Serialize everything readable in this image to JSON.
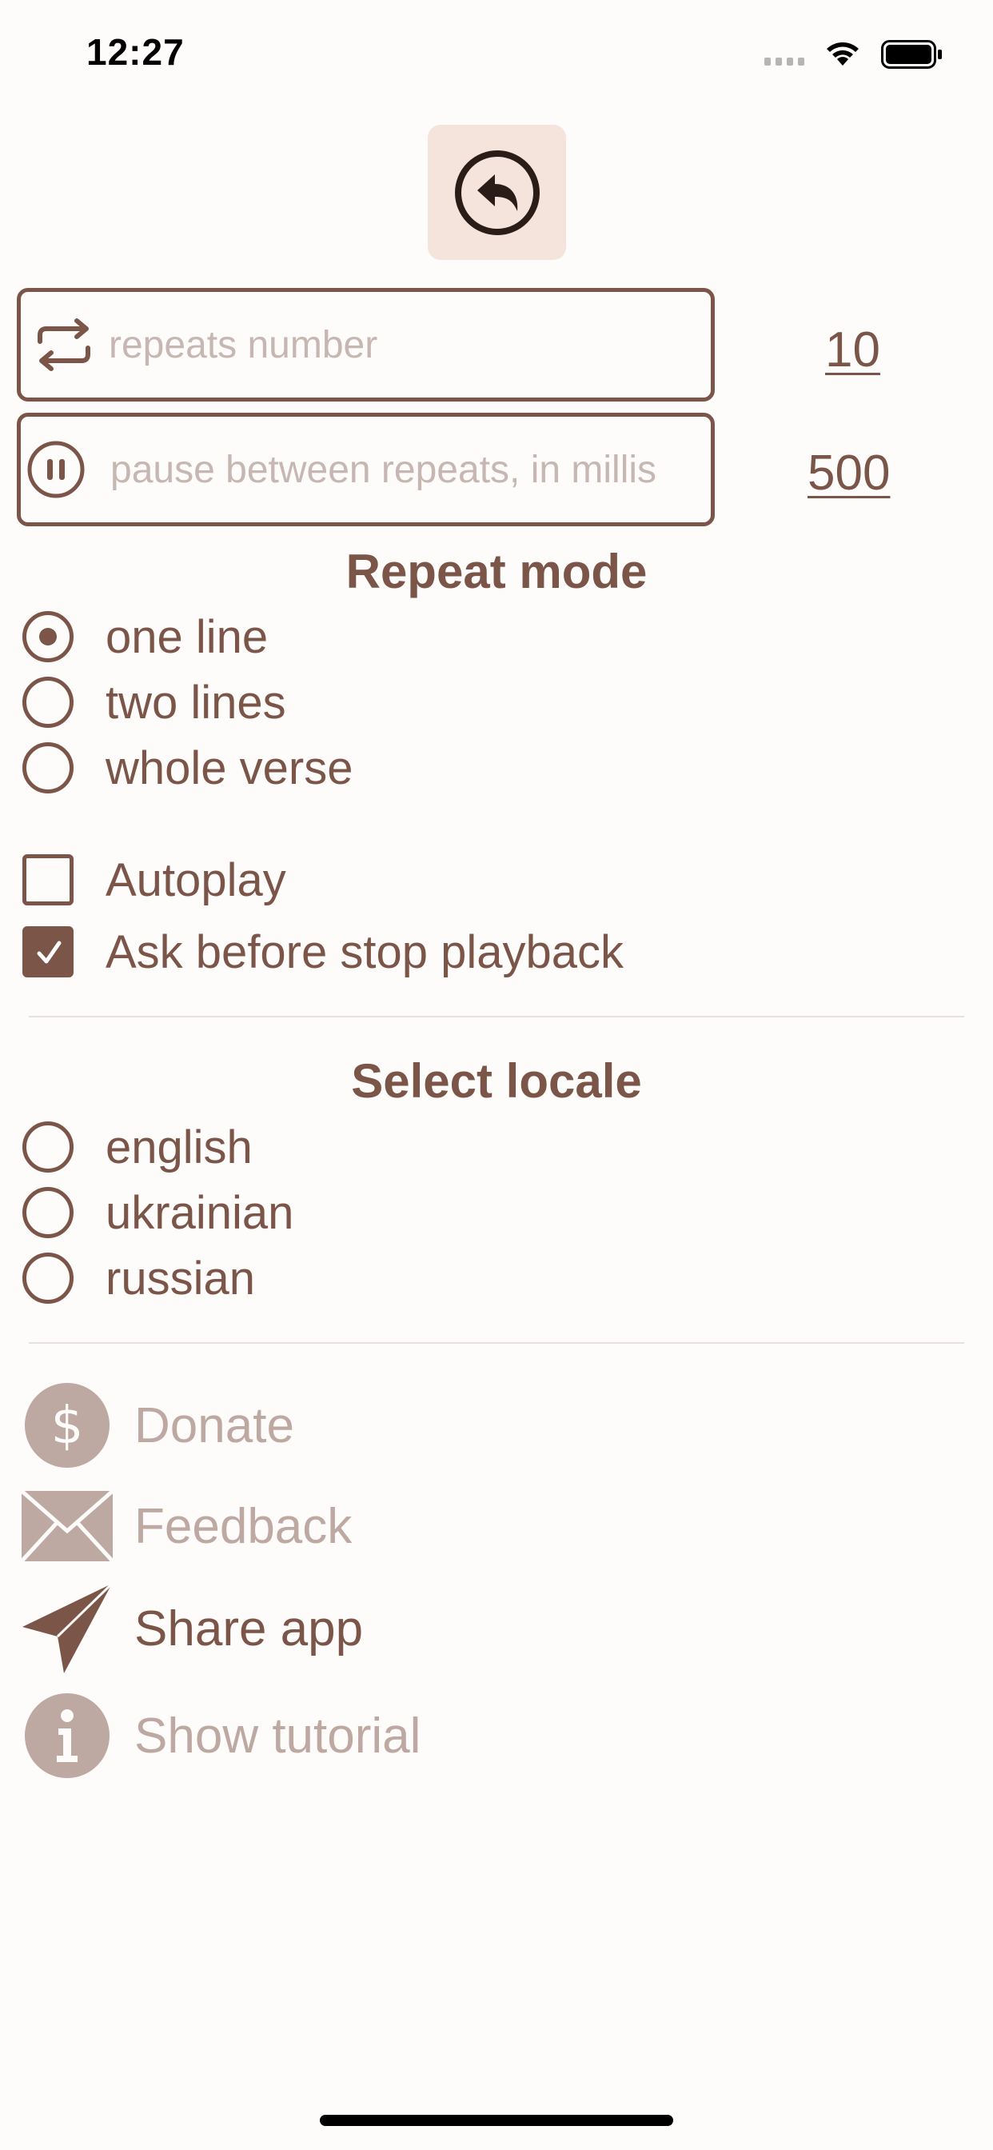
{
  "status_bar": {
    "time": "12:27"
  },
  "settings": {
    "repeats_field": {
      "placeholder": "repeats number",
      "value": "",
      "current": "10"
    },
    "pause_field": {
      "placeholder": "pause between repeats, in millis",
      "value": "",
      "current": "500"
    }
  },
  "repeat_mode": {
    "title": "Repeat mode",
    "options": [
      {
        "label": "one line",
        "selected": true
      },
      {
        "label": "two lines",
        "selected": false
      },
      {
        "label": "whole verse",
        "selected": false
      }
    ]
  },
  "toggles": [
    {
      "label": "Autoplay",
      "checked": false
    },
    {
      "label": "Ask before stop playback",
      "checked": true
    }
  ],
  "locale": {
    "title": "Select locale",
    "options": [
      {
        "label": "english",
        "selected": false
      },
      {
        "label": "ukrainian",
        "selected": false
      },
      {
        "label": "russian",
        "selected": false
      }
    ]
  },
  "actions": [
    {
      "label": "Donate",
      "icon": "dollar-circle-icon",
      "enabled": false
    },
    {
      "label": "Feedback",
      "icon": "envelope-icon",
      "enabled": false
    },
    {
      "label": "Share app",
      "icon": "paper-plane-icon",
      "enabled": true
    },
    {
      "label": "Show tutorial",
      "icon": "info-circle-icon",
      "enabled": false
    }
  ],
  "colors": {
    "accent": "#7B5548",
    "disabled": "#BDA8A2",
    "background": "#FEFBFB",
    "back_button_bg": "#F4E4DC"
  }
}
